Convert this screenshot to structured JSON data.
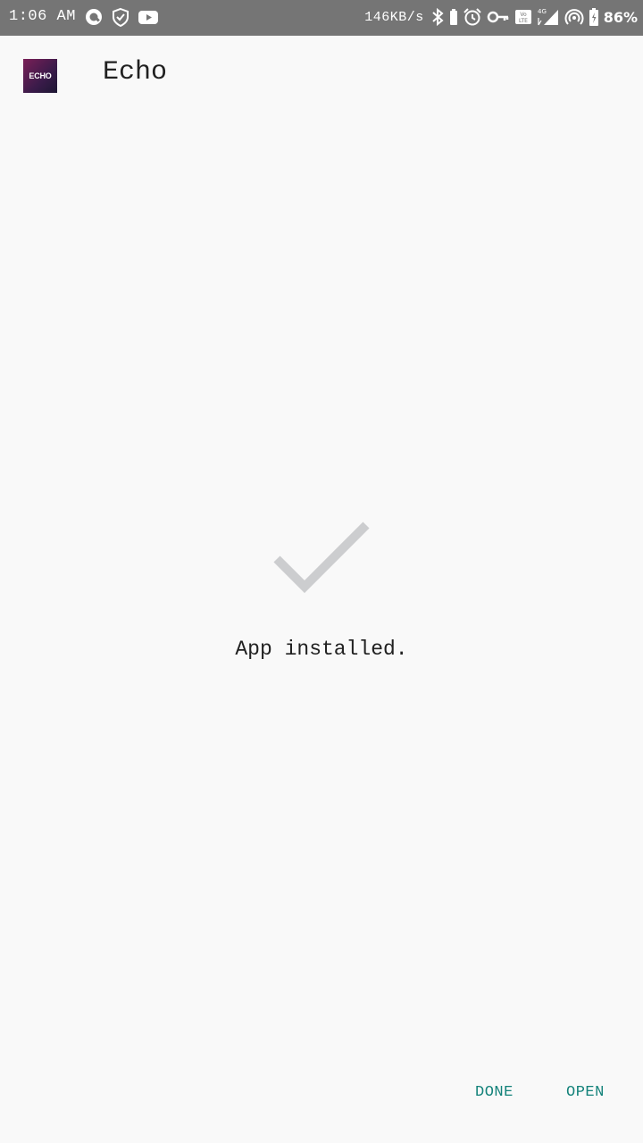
{
  "status_bar": {
    "time": "1:06 AM",
    "network_speed": "146KB/s",
    "battery_percent": "86%",
    "network_type": "4G",
    "left_icons": [
      "q-app-icon",
      "shield-check-icon",
      "youtube-icon"
    ],
    "right_icons": [
      "bluetooth-icon",
      "battery-saver-icon",
      "alarm-icon",
      "vpn-key-icon",
      "volte-icon",
      "signal-icon",
      "hotspot-icon",
      "battery-charging-icon"
    ]
  },
  "header": {
    "app_icon_text": "ECHO",
    "app_name": "Echo"
  },
  "main": {
    "status_icon": "checkmark-icon",
    "message": "App installed."
  },
  "actions": {
    "done_label": "DONE",
    "open_label": "OPEN"
  },
  "colors": {
    "status_bar_bg": "#757575",
    "page_bg": "#f9f9f9",
    "accent": "#13827a",
    "check_color": "#cccdcf"
  }
}
